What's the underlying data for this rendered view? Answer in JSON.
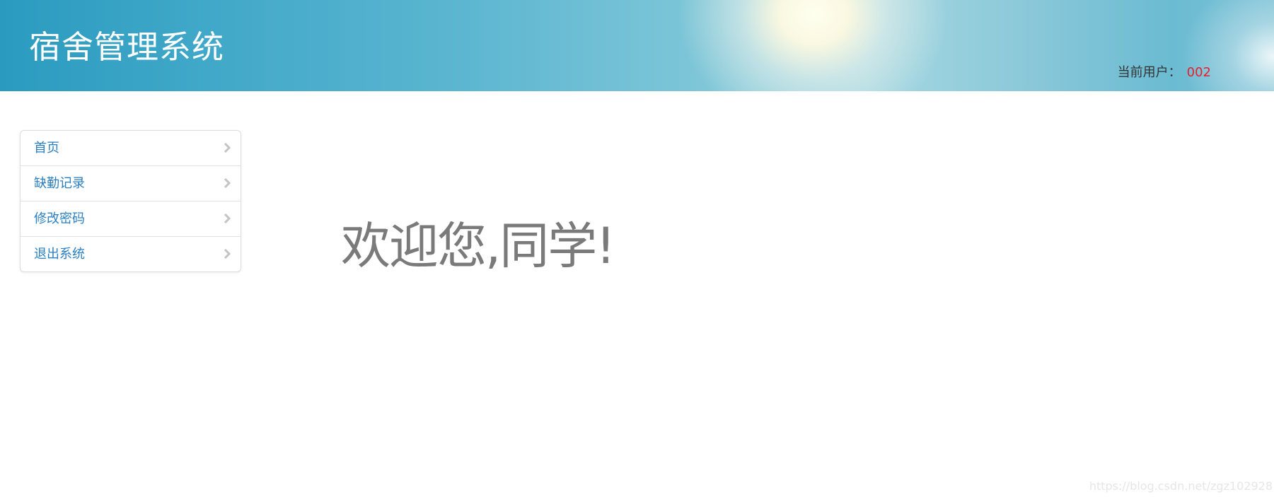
{
  "header": {
    "title": "宿舍管理系统",
    "current_user_label": "当前用户：",
    "current_user_value": "002"
  },
  "sidebar": {
    "items": [
      {
        "label": "首页",
        "icon": "chevron-right-icon"
      },
      {
        "label": "缺勤记录",
        "icon": "chevron-right-icon"
      },
      {
        "label": "修改密码",
        "icon": "chevron-right-icon"
      },
      {
        "label": "退出系统",
        "icon": "chevron-right-icon"
      }
    ]
  },
  "main": {
    "welcome_text": "欢迎您,同学!"
  },
  "watermark": "https://blog.csdn.net/zgz102928",
  "colors": {
    "header_accent": "#2a9bbf",
    "link": "#2a7fc2",
    "user_id": "#e4202d",
    "welcome": "#7a7a7a"
  }
}
